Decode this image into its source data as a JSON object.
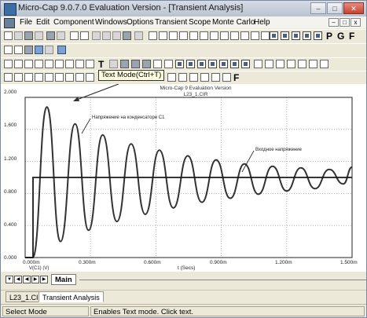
{
  "window": {
    "title": "Micro-Cap 9.0.7.0 Evaluation Version - [Transient Analysis]",
    "minimize_glyph": "–",
    "maximize_glyph": "□",
    "close_glyph": "✕"
  },
  "menu": {
    "items": [
      "File",
      "Edit",
      "Component",
      "Windows",
      "Options",
      "Transient",
      "Scope",
      "Monte Carlo",
      "Help"
    ],
    "mdi_buttons": [
      "–",
      "□",
      "x"
    ]
  },
  "toolbar": {
    "bold_glyphs": [
      "P",
      "G",
      "F"
    ],
    "text_mode_glyph": "T",
    "format_glyph": "F",
    "tooltip": "Text Mode(Ctrl+T)"
  },
  "chart_data": {
    "type": "line",
    "title": "Micro-Cap 9 Evaluation Version",
    "subtitle": "L23_1.CIR",
    "xlabel": "t (Secs)",
    "y_series_label": "V(C1) (V)",
    "x_tick_labels": [
      "0.000m",
      "0.300m",
      "0.600m",
      "0.900m",
      "1.200m",
      "1.500m"
    ],
    "y_tick_labels": [
      "0.000",
      "0.400",
      "0.800",
      "1.200",
      "1.600",
      "2.000"
    ],
    "xlim": [
      0.0,
      1.5
    ],
    "x_unit": "ms",
    "ylim": [
      0.0,
      2.0
    ],
    "grid": true,
    "series": [
      {
        "name": "Напряжение на конденсаторе C1",
        "color": "#333333",
        "x": [
          0.0,
          0.035,
          0.1,
          0.162,
          0.229,
          0.291,
          0.356,
          0.421,
          0.486,
          0.551,
          0.616,
          0.68,
          0.746,
          0.811,
          0.876,
          0.941,
          1.006,
          1.07,
          1.135,
          1.2,
          1.265,
          1.33,
          1.395,
          1.46,
          1.5
        ],
        "values": [
          0.0,
          0.0,
          1.88,
          0.2,
          1.67,
          0.34,
          1.53,
          0.45,
          1.42,
          0.54,
          1.34,
          0.62,
          1.27,
          0.69,
          1.22,
          0.74,
          1.17,
          0.79,
          1.14,
          0.83,
          1.12,
          0.86,
          1.1,
          0.92,
          1.13
        ]
      },
      {
        "name": "Входное напряжение",
        "color": "#1a1a1a",
        "x": [
          0.0,
          0.036,
          0.036,
          1.5
        ],
        "values": [
          0.0,
          0.0,
          1.0,
          1.0
        ]
      }
    ],
    "annotations": [
      "Напряжение на конденсаторе C1",
      "Входное напряжение"
    ]
  },
  "plot_tabs": {
    "active": "Main"
  },
  "doc_tabs": [
    "L23_1.CIR",
    "Transient Analysis"
  ],
  "status": {
    "mode": "Select Mode",
    "hint": "Enables Text mode. Click text."
  }
}
